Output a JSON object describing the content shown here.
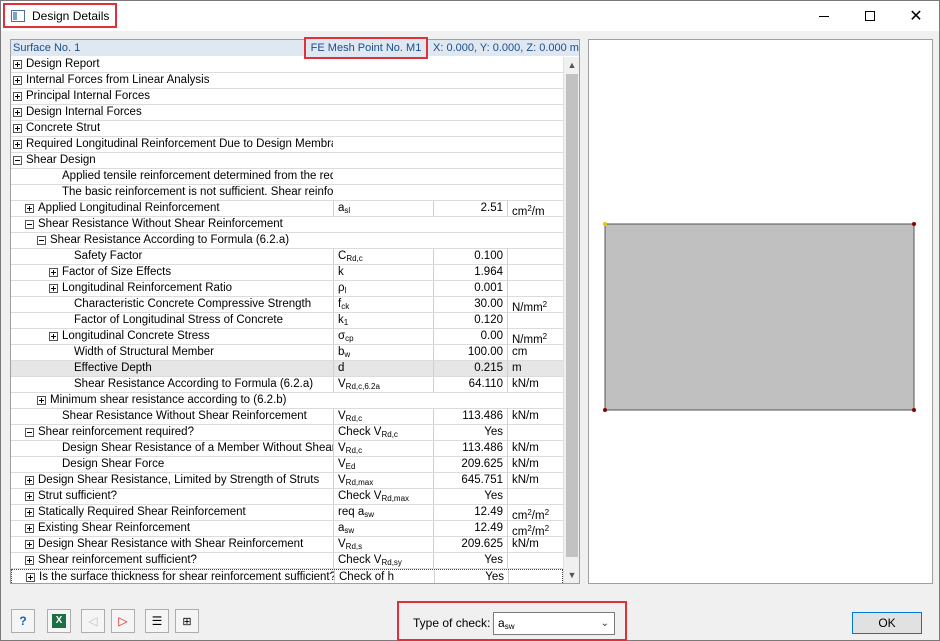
{
  "window": {
    "title": "Design Details"
  },
  "header": {
    "surface": "Surface No. 1",
    "mesh_point": "FE Mesh Point No. M1",
    "coords": "X: 0.000, Y: 0.000, Z: 0.000 m"
  },
  "rows": [
    {
      "label": "Design Report",
      "exp": "plus"
    },
    {
      "label": "Internal Forces from Linear Analysis",
      "exp": "plus"
    },
    {
      "label": "Principal Internal Forces",
      "exp": "plus"
    },
    {
      "label": "Design Internal Forces",
      "exp": "plus"
    },
    {
      "label": "Concrete Strut",
      "exp": "plus"
    },
    {
      "label": "Required Longitudinal Reinforcement Due to Design Membrane Forces",
      "exp": "plus"
    },
    {
      "label": "Shear Design",
      "exp": "minus"
    },
    {
      "label": "Applied tensile reinforcement determined from the required longitudinal reinforcement."
    },
    {
      "label": "The basic reinforcement is not sufficient. Shear reinforcement is required."
    },
    {
      "label": "Applied Longitudinal Reinforcement",
      "exp": "plus",
      "sym": "a",
      "sub": "sl",
      "value": "2.51",
      "unit": "cm",
      "unit_sup": "2",
      "unit_tail": "/m"
    },
    {
      "label": "Shear Resistance Without Shear Reinforcement",
      "exp": "minus"
    },
    {
      "label": "Shear Resistance According to Formula (6.2.a)",
      "exp": "minus"
    },
    {
      "label": "Safety Factor",
      "sym": "C",
      "sub": "Rd,c",
      "value": "0.100"
    },
    {
      "label": "Factor of Size Effects",
      "exp": "plus",
      "sym": "k",
      "value": "1.964"
    },
    {
      "label": "Longitudinal Reinforcement Ratio",
      "exp": "plus",
      "sym": "ρ",
      "sub": "l",
      "value": "0.001"
    },
    {
      "label": "Characteristic Concrete Compressive Strength",
      "sym": "f",
      "sub": "ck",
      "value": "30.00",
      "unit": "N/mm",
      "unit_sup": "2"
    },
    {
      "label": "Factor of Longitudinal Stress of Concrete",
      "sym": "k",
      "sub": "1",
      "value": "0.120"
    },
    {
      "label": "Longitudinal Concrete Stress",
      "exp": "plus",
      "sym": "σ",
      "sub": "cp",
      "value": "0.00",
      "unit": "N/mm",
      "unit_sup": "2"
    },
    {
      "label": "Width of Structural Member",
      "sym": "b",
      "sub": "w",
      "value": "100.00",
      "unit": "cm"
    },
    {
      "label": "Effective Depth",
      "sym": "d",
      "value": "0.215",
      "unit": "m"
    },
    {
      "label": "Shear Resistance According to Formula (6.2.a)",
      "sym": "V",
      "sub": "Rd,c,6.2a",
      "value": "64.110",
      "unit": "kN/m"
    },
    {
      "label": "Minimum shear resistance according to (6.2.b)",
      "exp": "plus"
    },
    {
      "label": "Shear Resistance Without Shear Reinforcement",
      "sym": "V",
      "sub": "Rd,c",
      "value": "113.486",
      "unit": "kN/m"
    },
    {
      "label": "Shear reinforcement required?",
      "exp": "minus",
      "sym": "Check V",
      "sub": "Rd,c",
      "value": "Yes"
    },
    {
      "label": "Design Shear Resistance of a Member Without Shear Rei",
      "sym": "V",
      "sub": "Rd,c",
      "value": "113.486",
      "unit": "kN/m"
    },
    {
      "label": "Design Shear Force",
      "sym": "V",
      "sub": "Ed",
      "value": "209.625",
      "unit": "kN/m"
    },
    {
      "label": "Design Shear Resistance, Limited by Strength of Struts",
      "exp": "plus",
      "sym": "V",
      "sub": "Rd,max",
      "value": "645.751",
      "unit": "kN/m"
    },
    {
      "label": "Strut sufficient?",
      "exp": "plus",
      "sym": "Check V",
      "sub": "Rd,max",
      "value": "Yes"
    },
    {
      "label": "Statically Required Shear Reinforcement",
      "exp": "plus",
      "sym": "req a",
      "sub": "sw",
      "value": "12.49",
      "unit": "cm",
      "unit_sup": "2",
      "unit_tail": "/m",
      "unit_sup2": "2"
    },
    {
      "label": "Existing Shear Reinforcement",
      "exp": "plus",
      "sym": "a",
      "sub": "sw",
      "value": "12.49",
      "unit": "cm",
      "unit_sup": "2",
      "unit_tail": "/m",
      "unit_sup2": "2"
    },
    {
      "label": "Design Shear Resistance with Shear Reinforcement",
      "exp": "plus",
      "sym": "V",
      "sub": "Rd,s",
      "value": "209.625",
      "unit": "kN/m"
    },
    {
      "label": "Shear reinforcement sufficient?",
      "exp": "plus",
      "sym": "Check V",
      "sub": "Rd,sy",
      "value": "Yes"
    },
    {
      "label": "Is the surface thickness for shear reinforcement sufficient?",
      "exp": "plus",
      "sym": "Check of h",
      "value": "Yes"
    }
  ],
  "bottom": {
    "type_label": "Type of check:",
    "type_value": "a",
    "type_value_sub": "sw",
    "ok": "OK"
  },
  "graphic": {
    "fill_color": "#c0c0c0",
    "node_color": "#8b0000"
  }
}
